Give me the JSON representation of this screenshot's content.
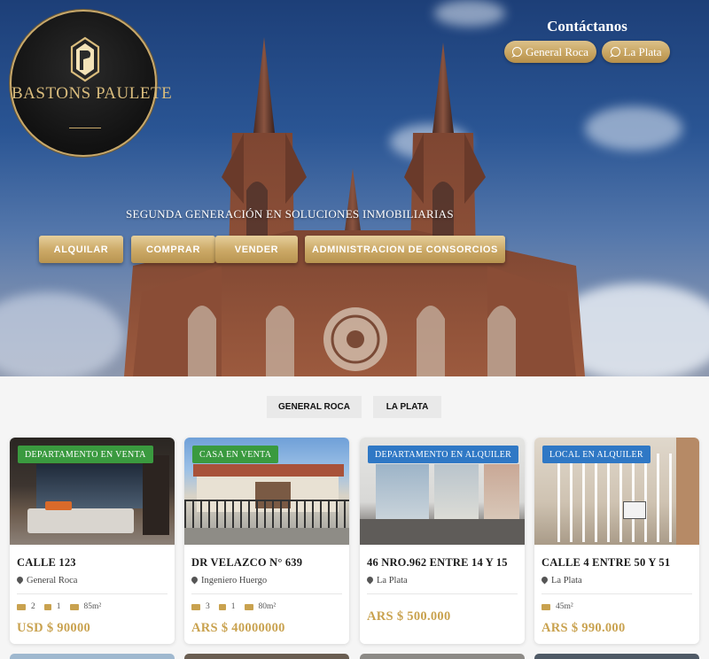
{
  "brand": {
    "name": "BASTONS PAULETE"
  },
  "contact": {
    "title": "Contáctanos",
    "buttons": [
      {
        "label": "General Roca",
        "icon": "whatsapp-icon"
      },
      {
        "label": "La Plata",
        "icon": "whatsapp-icon"
      }
    ]
  },
  "hero": {
    "tagline": "SEGUNDA GENERACIÓN EN SOLUCIONES INMOBILIARIAS",
    "buttons": [
      "ALQUILAR",
      "COMPRAR",
      "VENDER",
      "ADMINISTRACION DE CONSORCIOS"
    ]
  },
  "filters": [
    "GENERAL ROCA",
    "LA PLATA"
  ],
  "colors": {
    "gold": "#c9a24f",
    "badge_green": "#3a9a3f",
    "badge_blue": "#2f78c5",
    "logo_bg": "#121212"
  },
  "listings": [
    {
      "badge": "DEPARTAMENTO EN VENTA",
      "badge_color": "green",
      "title": "CALLE 123",
      "location": "General Roca",
      "beds": "2",
      "baths": "1",
      "area": "85m²",
      "price": "USD $ 90000"
    },
    {
      "badge": "CASA EN VENTA",
      "badge_color": "green",
      "title": "DR VELAZCO N° 639",
      "location": "Ingeniero Huergo",
      "beds": "3",
      "baths": "1",
      "area": "80m²",
      "price": "ARS $ 40000000"
    },
    {
      "badge": "DEPARTAMENTO EN ALQUILER",
      "badge_color": "blue",
      "title": "46 NRO.962 ENTRE 14 Y 15",
      "location": "La Plata",
      "beds": "",
      "baths": "",
      "area": "",
      "price": "ARS $ 500.000"
    },
    {
      "badge": "LOCAL EN ALQUILER",
      "badge_color": "blue",
      "title": "CALLE 4 ENTRE 50 Y 51",
      "location": "La Plata",
      "beds": "",
      "baths": "",
      "area": "45m²",
      "price": "ARS $ 990.000"
    }
  ]
}
